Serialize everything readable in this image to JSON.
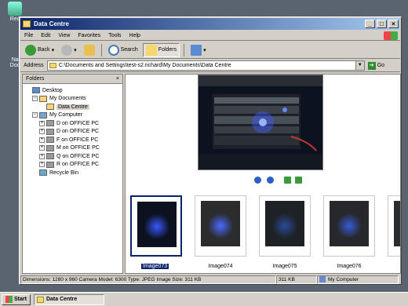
{
  "desktop": {
    "icons": [
      {
        "label": "Rec"
      },
      {
        "label": "Nav\nDoc"
      }
    ]
  },
  "window": {
    "title": "Data Centre"
  },
  "menu": [
    "File",
    "Edit",
    "View",
    "Favorites",
    "Tools",
    "Help"
  ],
  "toolbar": {
    "back": "Back",
    "search": "Search",
    "folders": "Folders"
  },
  "address": {
    "label": "Address",
    "value": "C:\\Documents and Settings\\test-s2.richard\\My Documents\\Data Centre",
    "go": "Go"
  },
  "folders_pane": {
    "title": "Folders",
    "close": "×",
    "tree": [
      {
        "label": "Desktop",
        "indent": 0,
        "exp": "",
        "icon": "desktop-icon"
      },
      {
        "label": "My Documents",
        "indent": 1,
        "exp": "−",
        "icon": "folder-icon"
      },
      {
        "label": "Data Centre",
        "indent": 2,
        "exp": "",
        "icon": "folder-icon",
        "selected": true
      },
      {
        "label": "My Computer",
        "indent": 1,
        "exp": "−",
        "icon": "computer-icon"
      },
      {
        "label": "D on  OFFICE  PC",
        "indent": 2,
        "exp": "+",
        "icon": "network-drive-icon"
      },
      {
        "label": "D on  OFFICE  PC",
        "indent": 2,
        "exp": "+",
        "icon": "network-drive-icon"
      },
      {
        "label": "F on  OFFICE  PC",
        "indent": 2,
        "exp": "+",
        "icon": "network-drive-icon"
      },
      {
        "label": "M on  OFFICE  PC",
        "indent": 2,
        "exp": "+",
        "icon": "network-drive-icon"
      },
      {
        "label": "Q on  OFFICE  PC",
        "indent": 2,
        "exp": "+",
        "icon": "network-drive-icon"
      },
      {
        "label": "R on  OFFICE  PC",
        "indent": 2,
        "exp": "+",
        "icon": "network-drive-icon"
      },
      {
        "label": "Recycle Bin",
        "indent": 1,
        "exp": "",
        "icon": "recycle-bin-icon"
      }
    ]
  },
  "thumbnails": [
    {
      "label": "Image073",
      "selected": true
    },
    {
      "label": "Image074"
    },
    {
      "label": "Image075"
    },
    {
      "label": "Image076"
    },
    {
      "label": "Image0"
    }
  ],
  "status": {
    "details": "Dimensions: 1280 x 960 Camera Model: 6300 Type: JPEG Image Size: 311 KB",
    "size": "311 KB",
    "zone": "My Computer"
  },
  "taskbar": {
    "start": "Start",
    "task": "Data Centre"
  }
}
